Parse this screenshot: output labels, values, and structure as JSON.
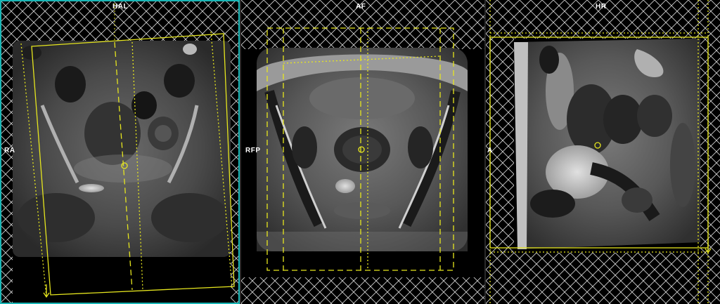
{
  "viewports": [
    {
      "id": "coronal",
      "top_label": "HAL",
      "side_label": "RA",
      "active": true
    },
    {
      "id": "axial",
      "top_label": "AF",
      "side_label": "RFP",
      "active": false
    },
    {
      "id": "sagittal",
      "top_label": "HR",
      "side_label": "A",
      "active": false
    }
  ],
  "colors": {
    "planning_box": "#e6e61e",
    "active_border": "#19b6b6",
    "hatch": "#d8d8d8"
  }
}
